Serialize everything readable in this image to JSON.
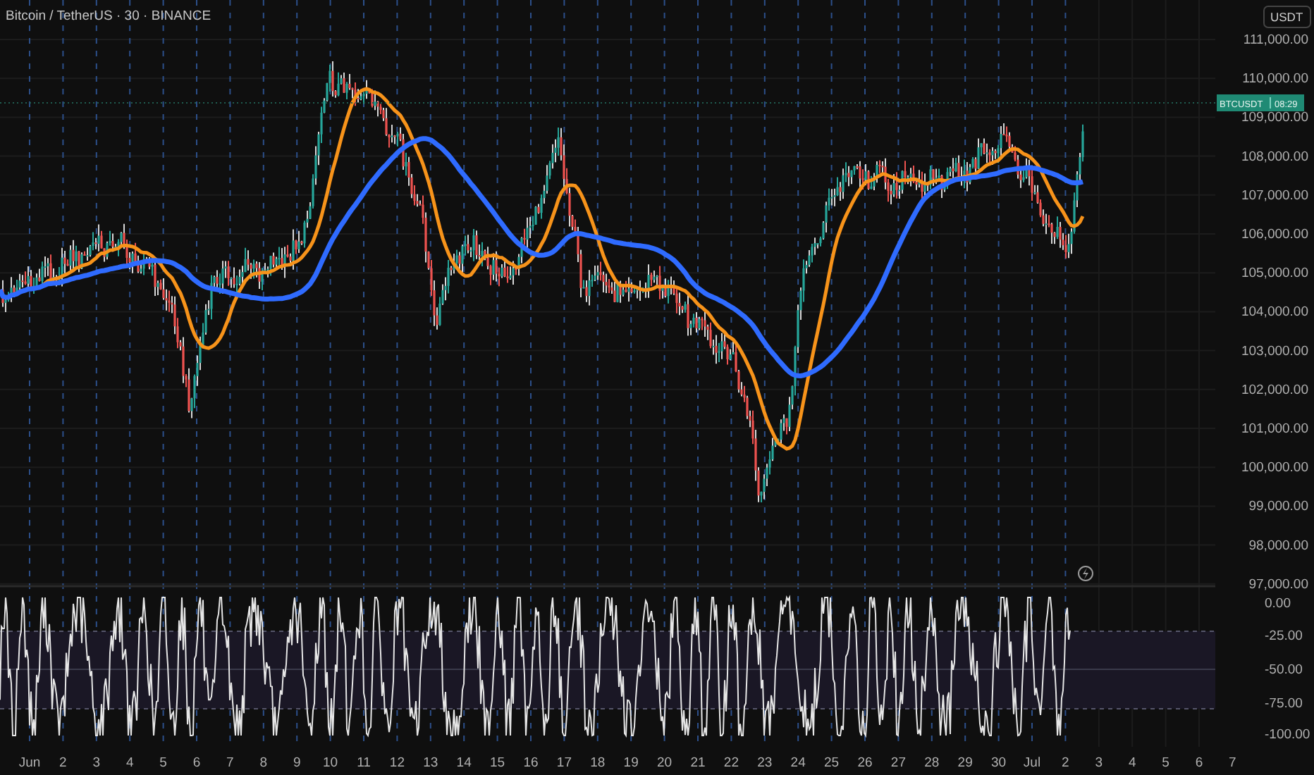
{
  "title": "Bitcoin / TetherUS · 30 · BINANCE",
  "price_axis": {
    "currency": "USDT",
    "ticks": [
      "111,000.00",
      "110,000.00",
      "109,000.00",
      "108,000.00",
      "107,000.00",
      "106,000.00",
      "105,000.00",
      "104,000.00",
      "103,000.00",
      "102,000.00",
      "101,000.00",
      "100,000.00",
      "99,000.00",
      "98,000.00",
      "97,000.00"
    ]
  },
  "last_price_label": {
    "symbol": "BTCUSDT",
    "countdown": "08:29"
  },
  "oscillator_axis": {
    "ticks": [
      "0.00",
      "-25.00",
      "-50.00",
      "-75.00",
      "-100.00"
    ]
  },
  "time_axis": {
    "labels": [
      "Jun",
      "2",
      "3",
      "4",
      "5",
      "6",
      "7",
      "8",
      "9",
      "10",
      "11",
      "12",
      "13",
      "14",
      "15",
      "16",
      "17",
      "18",
      "19",
      "20",
      "21",
      "22",
      "23",
      "24",
      "25",
      "26",
      "27",
      "28",
      "29",
      "30",
      "Jul",
      "2",
      "3",
      "4",
      "5",
      "6",
      "7"
    ]
  }
}
